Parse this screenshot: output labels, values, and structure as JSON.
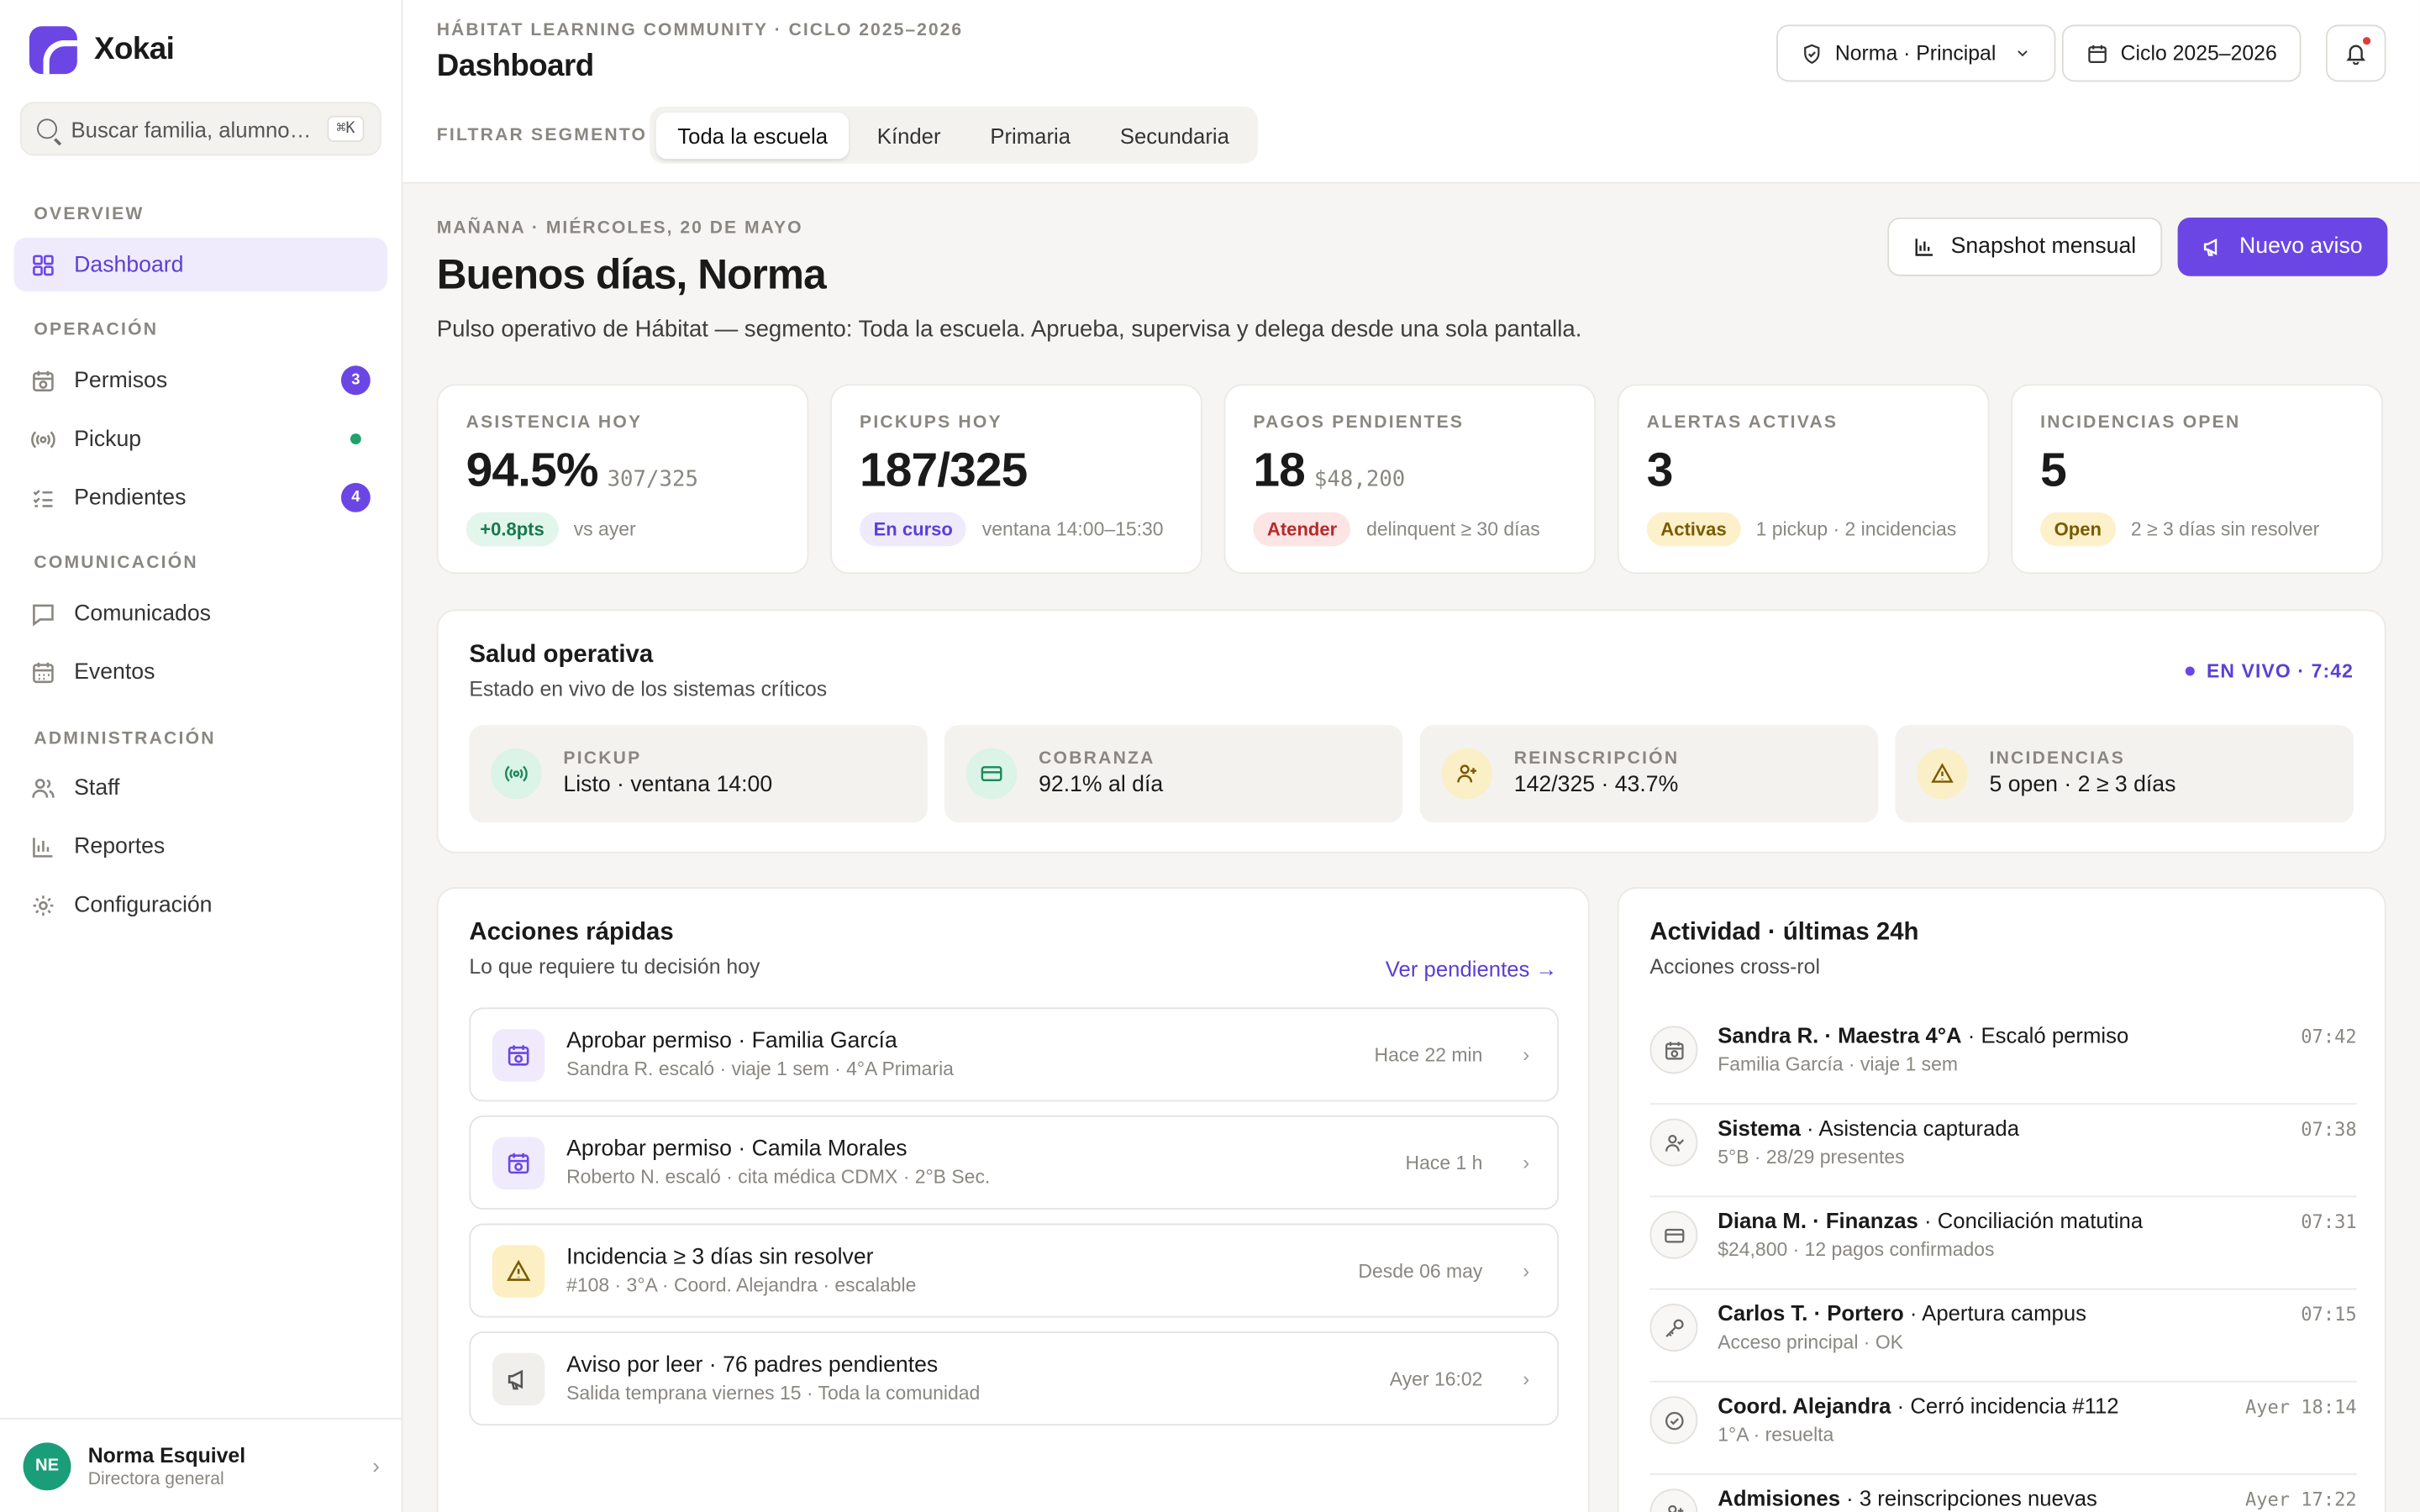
{
  "sidebar": {
    "brand": "Xokai",
    "search": {
      "placeholder": "Buscar familia, alumno…",
      "shortcut": "⌘K"
    },
    "sections": [
      {
        "title": "OVERVIEW"
      },
      {
        "title": "OPERACIÓN"
      },
      {
        "title": "COMUNICACIÓN"
      },
      {
        "title": "ADMINISTRACIÓN"
      }
    ],
    "items": [
      {
        "label": "Dashboard"
      },
      {
        "label": "Permisos",
        "badge": "3"
      },
      {
        "label": "Pickup"
      },
      {
        "label": "Pendientes",
        "badge": "4"
      },
      {
        "label": "Comunicados"
      },
      {
        "label": "Eventos"
      },
      {
        "label": "Staff"
      },
      {
        "label": "Reportes"
      },
      {
        "label": "Configuración"
      }
    ],
    "user": {
      "initials": "NE",
      "name": "Norma Esquivel",
      "role": "Directora general"
    }
  },
  "header": {
    "breadcrumb": "HÁBITAT LEARNING COMMUNITY · CICLO 2025–2026",
    "title": "Dashboard",
    "segment_label": "FILTRAR SEGMENTO",
    "segments": [
      "Toda la escuela",
      "Kínder",
      "Primaria",
      "Secundaria"
    ],
    "role_button": "Norma · Principal",
    "cycle_button": "Ciclo 2025–2026"
  },
  "main": {
    "date_line": "MAÑANA · MIÉRCOLES, 20 DE MAYO",
    "greeting": "Buenos días, Norma",
    "subtitle": "Pulso operativo de Hábitat — segmento: Toda la escuela. Aprueba, supervisa y delega desde una sola pantalla.",
    "snapshot_button": "Snapshot mensual",
    "new_notice_button": "Nuevo aviso",
    "kpis": [
      {
        "label": "ASISTENCIA HOY",
        "value": "94.5%",
        "secondary": "307/325",
        "pill": "+0.8pts",
        "note": "vs ayer"
      },
      {
        "label": "PICKUPS HOY",
        "value": "187/325",
        "secondary": "",
        "pill": "En curso",
        "note": "ventana 14:00–15:30"
      },
      {
        "label": "PAGOS PENDIENTES",
        "value": "18",
        "secondary": "$48,200",
        "pill": "Atender",
        "note": "delinquent ≥ 30 días"
      },
      {
        "label": "ALERTAS ACTIVAS",
        "value": "3",
        "secondary": "",
        "pill": "Activas",
        "note": "1 pickup · 2 incidencias"
      },
      {
        "label": "INCIDENCIAS OPEN",
        "value": "5",
        "secondary": "",
        "pill": "Open",
        "note": "2 ≥ 3 días sin resolver"
      }
    ],
    "health": {
      "title": "Salud operativa",
      "subtitle": "Estado en vivo de los sistemas críticos",
      "live": "EN VIVO · 7:42",
      "cells": [
        {
          "label": "PICKUP",
          "value": "Listo · ventana 14:00"
        },
        {
          "label": "COBRANZA",
          "value": "92.1% al día"
        },
        {
          "label": "REINSCRIPCIÓN",
          "value": "142/325 · 43.7%"
        },
        {
          "label": "INCIDENCIAS",
          "value": "5 open · 2 ≥ 3 días"
        }
      ]
    },
    "quick": {
      "title": "Acciones rápidas",
      "subtitle": "Lo que requiere tu decisión hoy",
      "link": "Ver pendientes →",
      "items": [
        {
          "title": "Aprobar permiso · Familia García",
          "sub": "Sandra R. escaló · viaje 1 sem · 4°A Primaria",
          "time": "Hace 22 min"
        },
        {
          "title": "Aprobar permiso · Camila Morales",
          "sub": "Roberto N. escaló · cita médica CDMX · 2°B Sec.",
          "time": "Hace 1 h"
        },
        {
          "title": "Incidencia ≥ 3 días sin resolver",
          "sub": "#108 · 3°A · Coord. Alejandra · escalable",
          "time": "Desde 06 may"
        },
        {
          "title": "Aviso por leer · 76 padres pendientes",
          "sub": "Salida temprana viernes 15 · Toda la comunidad",
          "time": "Ayer 16:02"
        }
      ]
    },
    "activity": {
      "title": "Actividad · últimas 24h",
      "subtitle": "Acciones cross-rol",
      "items": [
        {
          "actor": "Sandra R. · Maestra 4°A",
          "action": " · Escaló permiso",
          "sub": "Familia García · viaje 1 sem",
          "time": "07:42"
        },
        {
          "actor": "Sistema",
          "action": " · Asistencia capturada",
          "sub": "5°B · 28/29 presentes",
          "time": "07:38"
        },
        {
          "actor": "Diana M. · Finanzas",
          "action": " · Conciliación matutina",
          "sub": "$24,800 · 12 pagos confirmados",
          "time": "07:31"
        },
        {
          "actor": "Carlos T. · Portero",
          "action": " · Apertura campus",
          "sub": "Acceso principal · OK",
          "time": "07:15"
        },
        {
          "actor": "Coord. Alejandra",
          "action": " · Cerró incidencia #112",
          "sub": "1°A · resuelta",
          "time": "Ayer 18:14"
        },
        {
          "actor": "Admisiones",
          "action": " · 3 reinscripciones nuevas",
          "sub": "",
          "time": "Ayer 17:22"
        }
      ]
    }
  }
}
